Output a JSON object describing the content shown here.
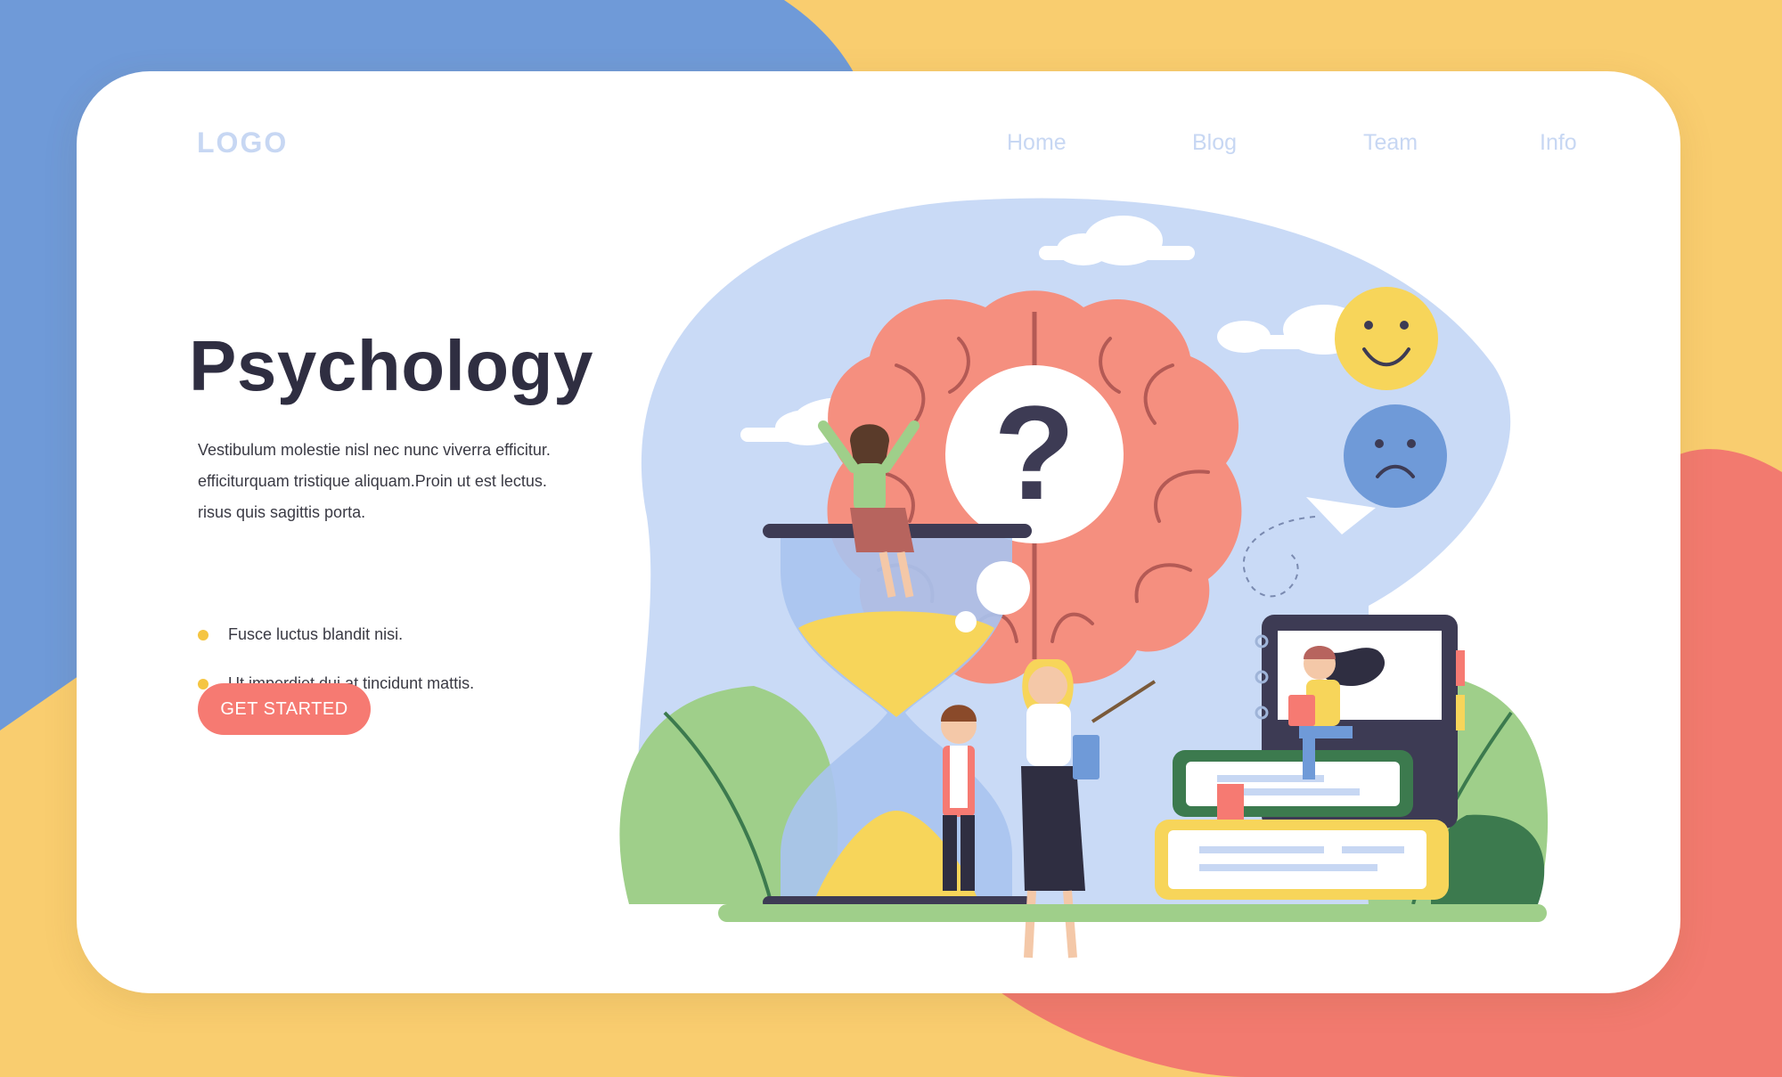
{
  "header": {
    "logo": "LOGO",
    "nav": [
      {
        "label": "Home"
      },
      {
        "label": "Blog"
      },
      {
        "label": "Team"
      },
      {
        "label": "Info"
      }
    ]
  },
  "hero": {
    "title": "Psychology",
    "description_lines": [
      "Vestibulum molestie nisl nec nunc viverra efficitur.",
      "efficiturquam tristique aliquam.Proin ut est lectus.",
      "risus quis sagittis porta."
    ],
    "bullets": [
      "Fusce luctus blandit nisi.",
      "Ut imperdiet dui at tincidunt mattis."
    ],
    "cta_label": "GET STARTED"
  },
  "illustration": {
    "question_mark": "?"
  },
  "colors": {
    "background_yellow": "#f9cd6f",
    "background_blue": "#6f9ad8",
    "background_coral": "#f27a6f",
    "card": "#ffffff",
    "nav_text": "#c7d7f3",
    "title": "#2f2e41",
    "bullet_dot": "#f5c542",
    "cta": "#f67a72",
    "brain": "#f58f7f",
    "blob": "#c9daf6"
  },
  "icons": [
    "brain-icon",
    "question-mark-icon",
    "happy-face-icon",
    "sad-face-icon",
    "hourglass-icon",
    "paper-plane-icon",
    "cloud-icon",
    "leaf-icon",
    "book-icon",
    "notebook-icon"
  ]
}
